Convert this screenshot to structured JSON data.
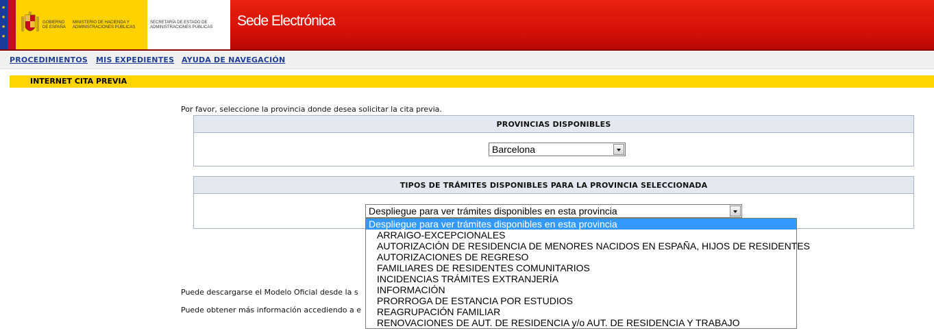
{
  "header": {
    "gobierno": "GOBIERNO DE ESPAÑA",
    "ministerio": "MINISTERIO DE HACIENDA Y ADMINISTRACIONES PÚBLICAS",
    "secretaria": "SECRETARÍA DE ESTADO DE ADMINISTRACIONES PÚBLICAS",
    "site_title": "Sede Electrónica",
    "colors": {
      "red": "#d81208",
      "yellow": "#ffd200",
      "eu_blue": "#1a3b9c"
    }
  },
  "nav": {
    "items": [
      {
        "label": "PROCEDIMIENTOS"
      },
      {
        "label": "MIS EXPEDIENTES"
      },
      {
        "label": "AYUDA DE NAVEGACIÓN"
      }
    ]
  },
  "section": {
    "title": "INTERNET CITA PREVIA"
  },
  "instruction": "Por favor, seleccione la provincia donde desea solicitar la cita previa.",
  "provinces": {
    "header": "PROVINCIAS DISPONIBLES",
    "selected": "Barcelona"
  },
  "tramites": {
    "header": "TIPOS DE TRÁMITES DISPONIBLES PARA LA PROVINCIA SELECCIONADA",
    "selected": "Despliegue para ver trámites disponibles en esta provincia",
    "options": [
      "Despliegue para ver trámites disponibles en esta provincia",
      "ARRAIGO-EXCEPCIONALES",
      "AUTORIZACIÓN DE RESIDENCIA DE MENORES NACIDOS EN ESPAÑA, HIJOS DE RESIDENTES",
      "AUTORIZACIONES DE REGRESO",
      "FAMILIARES DE RESIDENTES COMUNITARIOS",
      "INCIDENCIAS TRÁMITES EXTRANJERÍA",
      "INFORMACIÓN",
      "PRORROGA DE ESTANCIA POR ESTUDIOS",
      "REAGRUPACIÓN FAMILIAR",
      "RENOVACIONES DE AUT. DE RESIDENCIA y/o AUT. DE RESIDENCIA Y TRABAJO"
    ]
  },
  "footer": {
    "line1": "Puede descargarse el Modelo Oficial desde la s",
    "line2": "Puede obtener más información accediendo a e"
  }
}
